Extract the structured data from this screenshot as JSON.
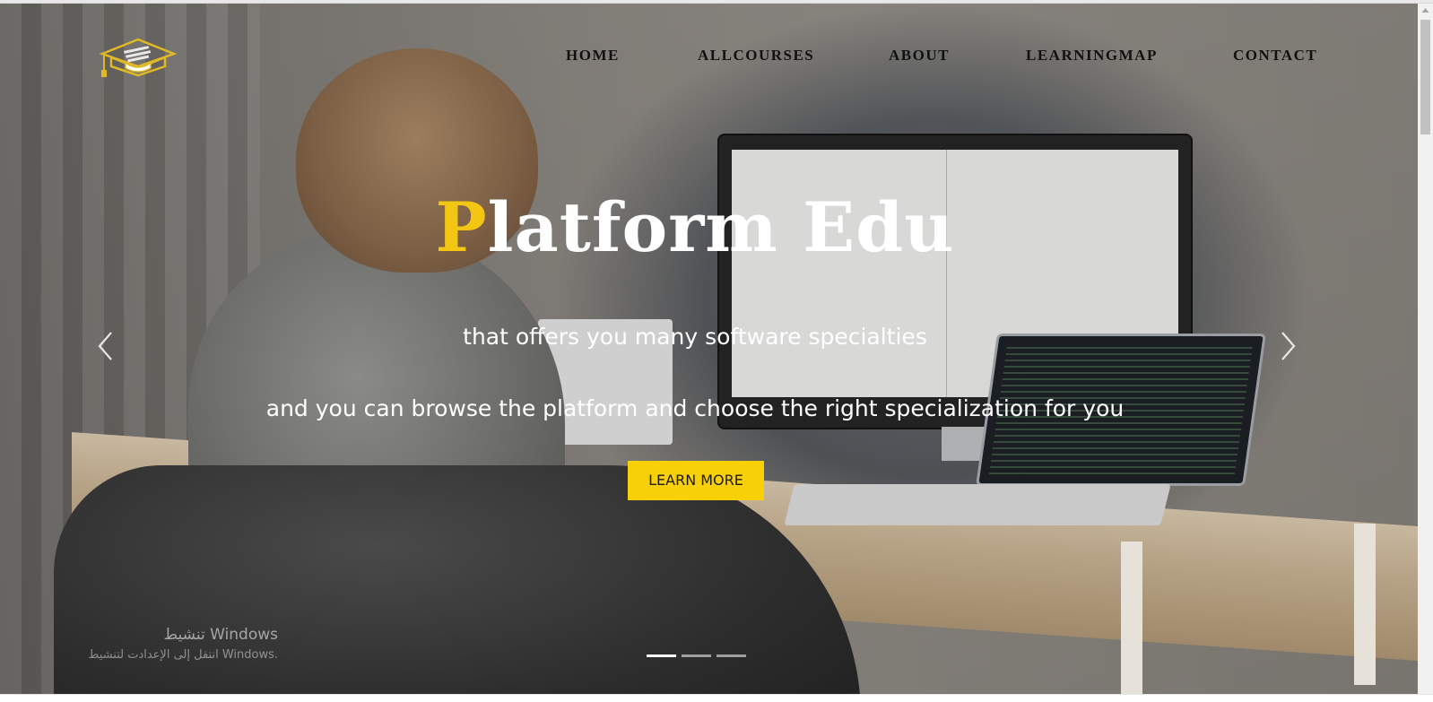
{
  "brand": {
    "logo_icon": "graduation-cap-icon",
    "accent_color": "#f2c612"
  },
  "nav": [
    {
      "label": "HOME"
    },
    {
      "label": "ALLCOURSES"
    },
    {
      "label": "ABOUT"
    },
    {
      "label": "LEARNINGMAP"
    },
    {
      "label": "CONTACT"
    }
  ],
  "hero": {
    "title_first_letter": "P",
    "title_rest": "latform Edu",
    "subtitle_1": "that offers you many software specialties",
    "subtitle_2": "and you can browse the platform and choose the right specialization for you",
    "button_label": "LEARN MORE",
    "button_color": "#f7d007",
    "prev_icon": "chevron-left-icon",
    "next_icon": "chevron-right-icon",
    "slides_total": 3,
    "active_slide": 1
  },
  "windows_watermark": {
    "title": "تنشيط Windows",
    "subtitle": "انتقل إلى الإعدادت لتنشيط Windows."
  }
}
